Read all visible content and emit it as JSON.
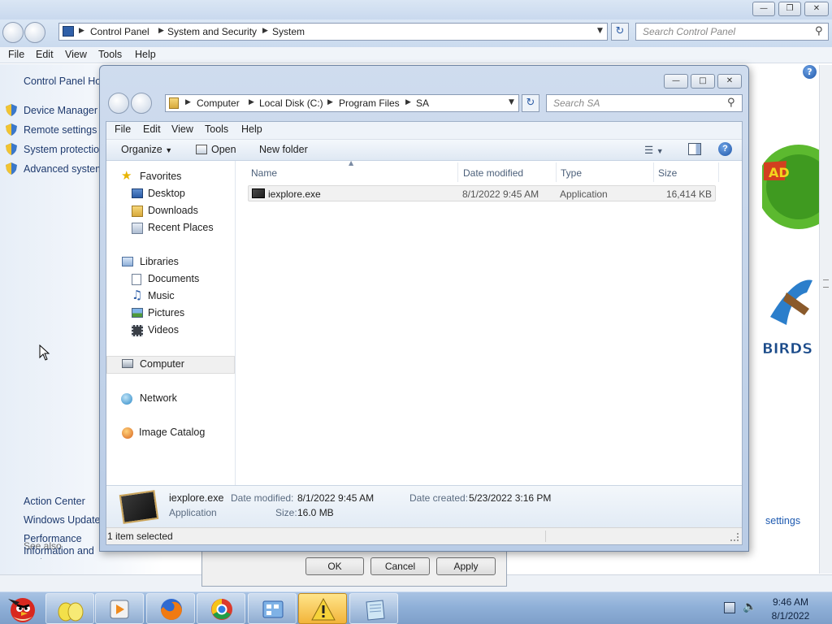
{
  "control_panel": {
    "breadcrumbs": [
      "Control Panel",
      "System and Security",
      "System"
    ],
    "search_placeholder": "Search Control Panel",
    "menu": [
      "File",
      "Edit",
      "View",
      "Tools",
      "Help"
    ],
    "home_link": "Control Panel Home",
    "tasks": [
      "Device Manager",
      "Remote settings",
      "System protection",
      "Advanced system settings"
    ],
    "see_also_label": "See also",
    "see_also_links": [
      "Action Center",
      "Windows Update",
      "Performance Information and Tools"
    ],
    "change_settings_link": "settings"
  },
  "explorer": {
    "breadcrumbs": [
      "Computer",
      "Local Disk (C:)",
      "Program Files",
      "SA"
    ],
    "search_placeholder": "Search SA",
    "menu": [
      "File",
      "Edit",
      "View",
      "Tools",
      "Help"
    ],
    "toolbar": {
      "organize": "Organize",
      "open": "Open",
      "new_folder": "New folder"
    },
    "nav": {
      "favorites": "Favorites",
      "desktop": "Desktop",
      "downloads": "Downloads",
      "recent_places": "Recent Places",
      "libraries": "Libraries",
      "documents": "Documents",
      "music": "Music",
      "pictures": "Pictures",
      "videos": "Videos",
      "computer": "Computer",
      "network": "Network",
      "image_catalog": "Image Catalog"
    },
    "columns": {
      "name": "Name",
      "date_modified": "Date modified",
      "type": "Type",
      "size": "Size"
    },
    "files": [
      {
        "name": "iexplore.exe",
        "date_modified": "8/1/2022 9:45 AM",
        "type": "Application",
        "size": "16,414 KB"
      }
    ],
    "details": {
      "name": "iexplore.exe",
      "type": "Application",
      "date_modified_label": "Date modified:",
      "date_modified": "8/1/2022 9:45 AM",
      "date_created_label": "Date created:",
      "date_created": "5/23/2022 3:16 PM",
      "size_label": "Size:",
      "size": "16.0 MB"
    },
    "status": "1 item selected"
  },
  "properties_dialog": {
    "ok": "OK",
    "cancel": "Cancel",
    "apply": "Apply"
  },
  "taskbar": {
    "time": "9:46 AM",
    "date": "8/1/2022"
  },
  "colors": {
    "accent": "#1e5ab0",
    "taskbar": "#8fb0d8",
    "selection": "#f1f1f1",
    "warning": "#f2b43a"
  }
}
